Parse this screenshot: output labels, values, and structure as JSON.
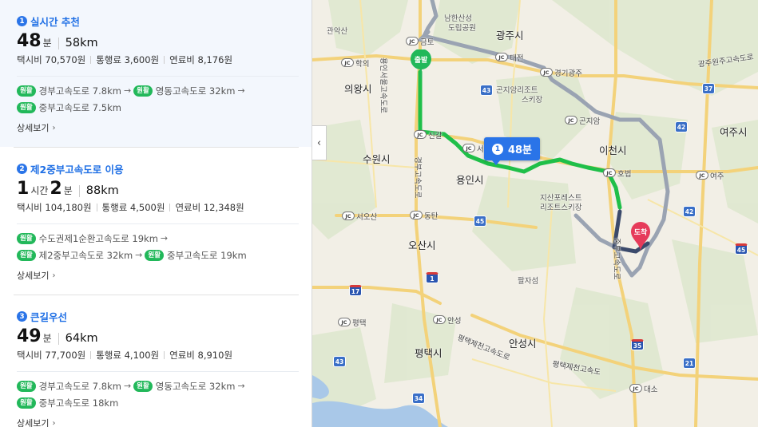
{
  "routes": [
    {
      "num": "1",
      "name": "실시간 추천",
      "hours": "",
      "hours_unit": "",
      "minutes": "48",
      "minutes_unit": "분",
      "distance": "58km",
      "taxi": "택시비 70,570원",
      "toll": "통행료 3,600원",
      "fuel": "연료비 8,176원",
      "roads": [
        [
          {
            "badge": "원활",
            "text": "경부고속도로 7.8km"
          },
          {
            "badge": "원활",
            "text": "영동고속도로 32km"
          }
        ],
        [
          {
            "badge": "원활",
            "text": "중부고속도로 7.5km"
          }
        ]
      ],
      "detail": "상세보기"
    },
    {
      "num": "2",
      "name": "제2중부고속도로 이용",
      "hours": "1",
      "hours_unit": "시간",
      "minutes": "2",
      "minutes_unit": "분",
      "distance": "88km",
      "taxi": "택시비 104,180원",
      "toll": "통행료 4,500원",
      "fuel": "연료비 12,348원",
      "roads": [
        [
          {
            "badge": "원활",
            "text": "수도권제1순환고속도로 19km"
          }
        ],
        [
          {
            "badge": "원활",
            "text": "제2중부고속도로 32km"
          },
          {
            "badge": "원활",
            "text": "중부고속도로 19km"
          }
        ]
      ],
      "detail": "상세보기"
    },
    {
      "num": "3",
      "name": "큰길우선",
      "hours": "",
      "hours_unit": "",
      "minutes": "49",
      "minutes_unit": "분",
      "distance": "64km",
      "taxi": "택시비 77,700원",
      "toll": "통행료 4,100원",
      "fuel": "연료비 8,910원",
      "roads": [
        [
          {
            "badge": "원활",
            "text": "경부고속도로 7.8km"
          },
          {
            "badge": "원활",
            "text": "영동고속도로 32km"
          }
        ],
        [
          {
            "badge": "원활",
            "text": "중부고속도로 18km"
          }
        ]
      ],
      "detail": "상세보기"
    }
  ],
  "map": {
    "callout_num": "1",
    "callout_time": "48분",
    "start_label": "출발",
    "end_label": "도착",
    "cities": [
      "광주시",
      "의왕시",
      "수원시",
      "용인시",
      "이천시",
      "여주시",
      "오산시",
      "평택시",
      "안성시"
    ],
    "places": [
      "남한산성",
      "도립공원",
      "관악산",
      "곤지암리조트",
      "스키장",
      "지산포레스트",
      "리조트스키장",
      "팔자섬"
    ],
    "jc_labels": [
      "금토",
      "학의",
      "태전",
      "경기광주",
      "곤지암",
      "신갈",
      "서",
      "호법",
      "여주",
      "서오산",
      "동탄",
      "안성",
      "평택",
      "대소"
    ],
    "road_labels": [
      "용인서울고속도로",
      "경부고속도로",
      "중부고속도로",
      "평택제천고속도로",
      "평택제천고속도",
      "광주원주고속도로"
    ],
    "shields": [
      "43",
      "42",
      "37",
      "42",
      "45",
      "17",
      "1",
      "43",
      "34",
      "35",
      "21",
      "45",
      "45"
    ],
    "colors": {
      "route_main": "#1fbf49",
      "route_alt": "#9aa3b2",
      "route_dark": "#3b4a6b",
      "accent": "#2a74e8",
      "end_pin": "#e63b5a",
      "start_pin": "#22b85a"
    }
  }
}
